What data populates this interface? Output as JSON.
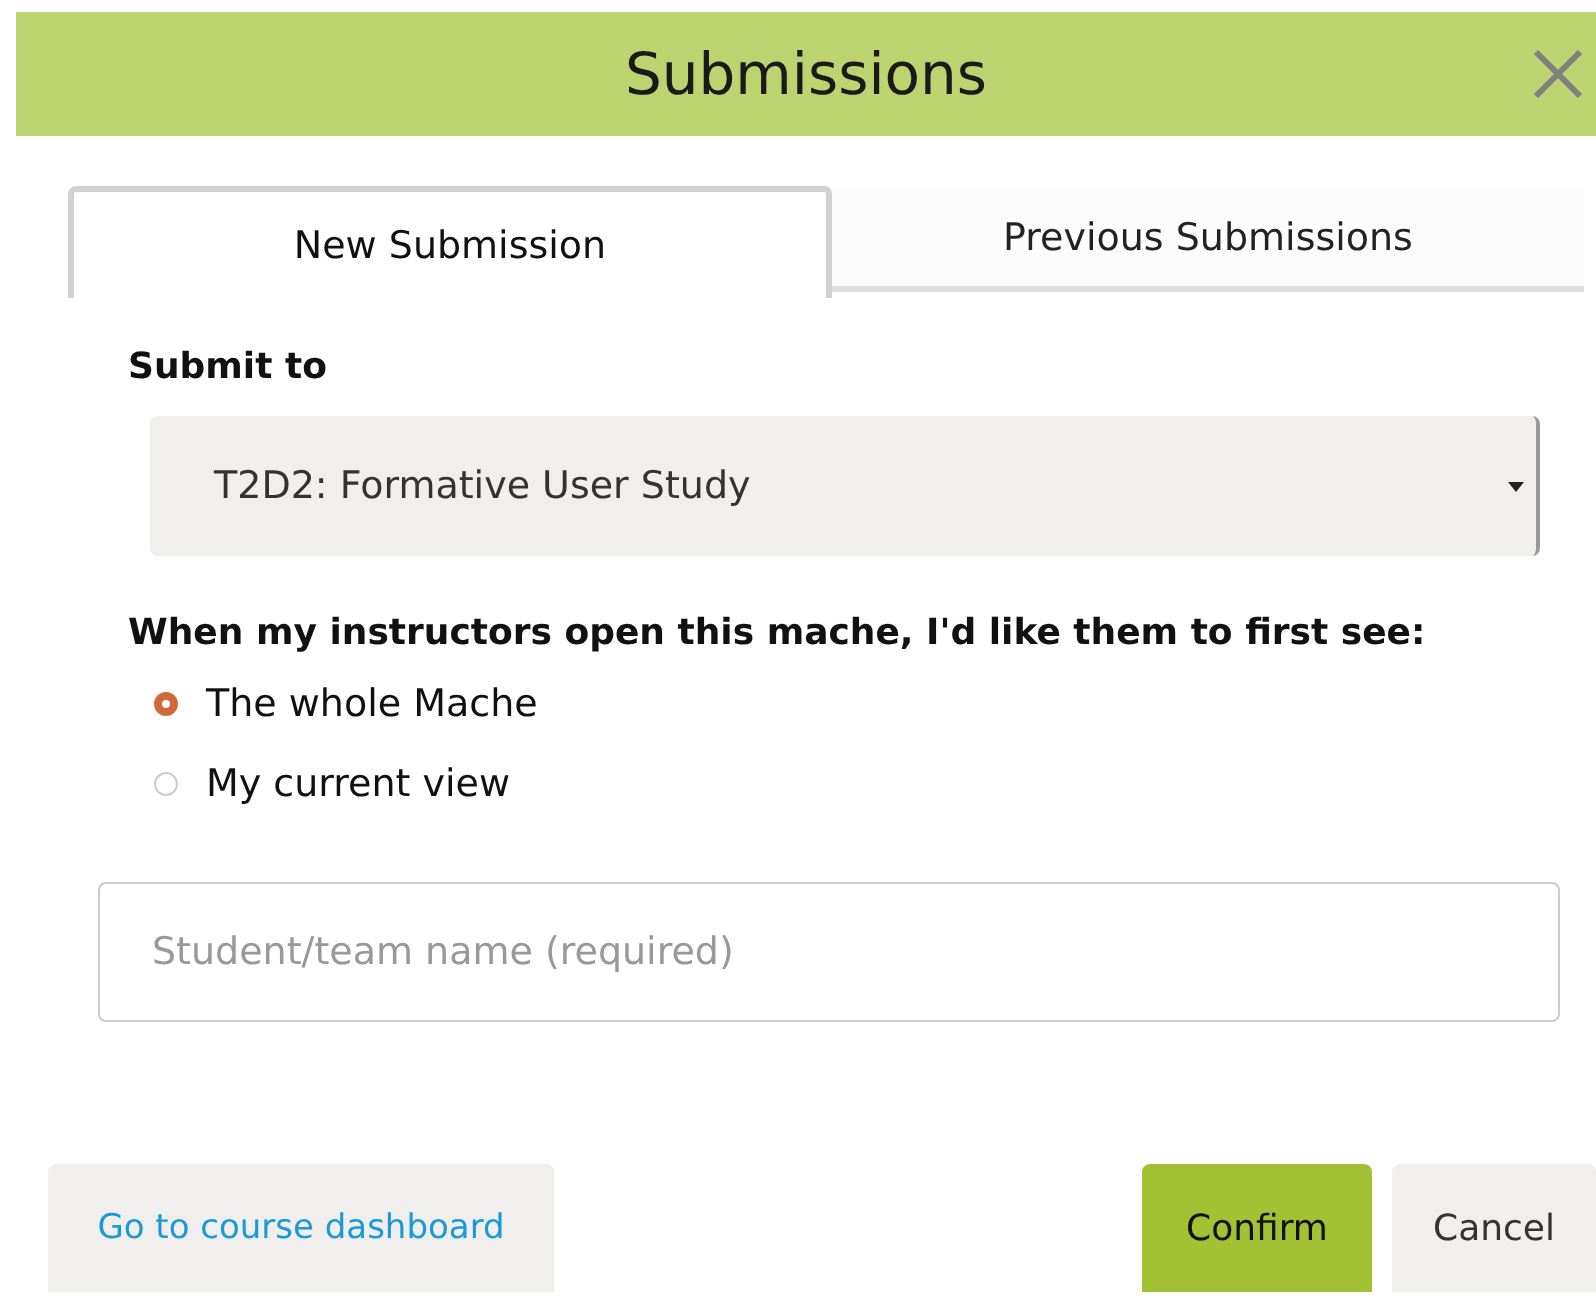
{
  "window": {
    "title": "Submissions"
  },
  "tabs": [
    {
      "label": "New Submission",
      "selected": true
    },
    {
      "label": "Previous Submissions",
      "selected": false
    }
  ],
  "submit_to": {
    "label": "Submit to",
    "value": "T2D2: Formative User Study"
  },
  "first_view": {
    "label": "When my instructors open this mache, I'd like them to first see:",
    "options": [
      {
        "label": "The whole Mache",
        "selected": true
      },
      {
        "label": "My current view",
        "selected": false
      }
    ]
  },
  "name_field": {
    "placeholder": "Student/team name (required)"
  },
  "buttons": [
    {
      "label": "Go to course dashboard",
      "kind": "link"
    },
    {
      "label": "Confirm",
      "kind": "primary"
    },
    {
      "label": "Cancel",
      "kind": "secondary"
    }
  ]
}
